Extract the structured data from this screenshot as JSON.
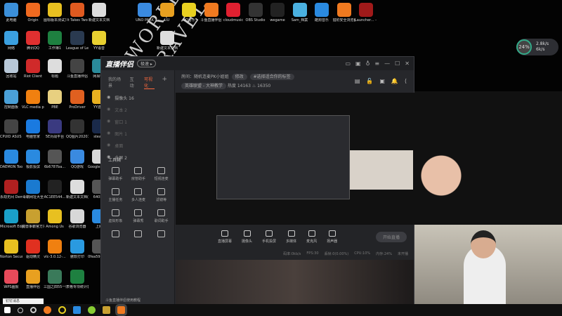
{
  "desktop": {
    "decor": [
      "WORLD",
      "TRAVEL"
    ],
    "columns": [
      [
        {
          "label": "此电脑",
          "color": "#3b8fd9"
        },
        {
          "label": "网络",
          "color": "#3ba0e0"
        },
        {
          "label": "回收站",
          "color": "#b8c8d8"
        },
        {
          "label": "控制面板",
          "color": "#4aa0d8"
        },
        {
          "label": "CPUID ASUS CPU-Z",
          "color": "#444"
        },
        {
          "label": "DAEMON Tools Lite",
          "color": "#2a8ae0"
        },
        {
          "label": "永劫无间 Demo",
          "color": "#b02020"
        },
        {
          "label": "Microsoft Edge",
          "color": "#1aa0c8"
        },
        {
          "label": "Norton Security",
          "color": "#e8c020"
        },
        {
          "label": "WPS画报",
          "color": "#e84a5a"
        }
      ],
      [
        {
          "label": "Origin",
          "color": "#f06a20"
        },
        {
          "label": "腾讯QQ",
          "color": "#e03030"
        },
        {
          "label": "Riot Client",
          "color": "#d02a2a"
        },
        {
          "label": "VLC media player",
          "color": "#f08010"
        },
        {
          "label": "电脑管家",
          "color": "#1a7ae0"
        },
        {
          "label": "极影投屏",
          "color": "#2a8ae0"
        },
        {
          "label": "毒霸网址大全",
          "color": "#1a7ad0"
        },
        {
          "label": "魔兽争霸官方对战平台",
          "color": "#c8a030"
        },
        {
          "label": "驱动精灵",
          "color": "#e03020"
        },
        {
          "label": "直播伴侣",
          "color": "#e8a020"
        }
      ],
      [
        {
          "label": "图标版本测试文档",
          "color": "#e8c020"
        },
        {
          "label": "工作簿1",
          "color": "#1e8040"
        },
        {
          "label": "标题",
          "color": "#ddd"
        },
        {
          "label": "PBE",
          "color": "#e8d080"
        },
        {
          "label": "5E对战平台",
          "color": "#3a3a80"
        },
        {
          "label": "6b6787ba...",
          "color": "#555"
        },
        {
          "label": "AC1EE544...",
          "color": "#222"
        },
        {
          "label": "Among Us",
          "color": "#e8c020"
        },
        {
          "label": "vlc-3.0.12-...",
          "color": "#f08010"
        },
        {
          "label": "三国之四55一图上站",
          "color": "#3a7a5a"
        }
      ],
      [
        {
          "label": "It Takes Two",
          "color": "#e05a20"
        },
        {
          "label": "League of Legends",
          "color": "#2a3a50"
        },
        {
          "label": "斗鱼直播伴侣",
          "color": "#444"
        },
        {
          "label": "ProDriver",
          "color": "#e06020"
        },
        {
          "label": "QQ图片20201102...",
          "color": "#333"
        },
        {
          "label": "QQ游戏",
          "color": "#3a8ae0"
        },
        {
          "label": "新建文本文档(2)",
          "color": "#ddd"
        },
        {
          "label": "谷歌浏览器",
          "color": "#d8d8d8"
        },
        {
          "label": "傲软打印",
          "color": "#2a9ae0"
        },
        {
          "label": "表格专项统计表",
          "color": "#1e8040"
        }
      ],
      [
        {
          "label": "新建文本文档",
          "color": "#ddd"
        },
        {
          "label": "YY语音",
          "color": "#e8d030"
        },
        {
          "label": "网易UU",
          "color": "#2a8a9a"
        },
        {
          "label": "YY游戏",
          "color": "#e8b020"
        },
        {
          "label": "steam",
          "color": "#1a2a4a"
        },
        {
          "label": "Google Chrome",
          "color": "#d8d8d8"
        },
        {
          "label": "640F...",
          "color": "#555"
        },
        {
          "label": "上网",
          "color": "#2a8ae0"
        },
        {
          "label": "0fea5925b...",
          "color": "#555"
        }
      ]
    ],
    "top_row": [
      {
        "label": "UNO PARK",
        "color": "#3a8ae0"
      },
      {
        "label": "UU",
        "color": "#e8a020"
      },
      {
        "label": "QQ音乐",
        "color": "#e8d020"
      },
      {
        "label": "斗鱼直播伴侣",
        "color": "#f07a20"
      },
      {
        "label": "cloudmusic",
        "color": "#e02030"
      },
      {
        "label": "OBS Studio",
        "color": "#333"
      },
      {
        "label": "wegame",
        "color": "#222"
      },
      {
        "label": "Sam_档案",
        "color": "#4ab0e0"
      },
      {
        "label": "酷狗音乐",
        "color": "#2a8ae0"
      },
      {
        "label": "猎豹安全浏览器",
        "color": "#f07a20"
      },
      {
        "label": "Launcher... - 快捷方式",
        "color": "#a01a1a"
      }
    ],
    "extra": [
      {
        "label": "新建文本文档",
        "color": "#ddd"
      }
    ]
  },
  "app": {
    "logo": "直播伴侣",
    "badge": "极速 ▸",
    "window_buttons": [
      "▭",
      "▣",
      "♁",
      "≡",
      "—",
      "☐",
      "✕"
    ],
    "tabs": [
      "我的场景",
      "互动",
      "可视化"
    ],
    "add": "+",
    "scenes": [
      {
        "label": "摄像头 16",
        "on": true
      },
      {
        "label": "文本 2",
        "on": false
      },
      {
        "label": "窗口 1",
        "on": false
      },
      {
        "label": "图片 1",
        "on": false
      },
      {
        "label": "桌面",
        "on": false
      },
      {
        "label": "全屏 2",
        "on": true
      }
    ],
    "tools_title": "工具箱",
    "tools": [
      "弹幕助手",
      "房管助手",
      "短视连麦",
      "主播任务",
      "多人连麦",
      "滤镜等",
      "虚拟形象",
      "弹幕秀",
      "歌词助手",
      "",
      "",
      ""
    ],
    "tip": "斗鱼直播伴侣使用教程",
    "header": {
      "title_label": "房间：",
      "title": "随机连麦PK小姐姐",
      "edit": "修改",
      "tag": "#选择适合你的标签",
      "category": "英雄联盟 - 大神教学",
      "fans_label": "热度",
      "fans": "14163",
      "hot": "16350"
    },
    "header_icons": [
      "▤",
      "🔓",
      "▣",
      "🔔",
      "⟨"
    ],
    "bottom": [
      "直播屏幕",
      "摄像头",
      "手机投屏",
      "多媒体",
      "麦克风",
      "扬声器"
    ],
    "go_live": "开始直播",
    "stats": [
      "码率:0kb/s",
      "FPS:30",
      "丢帧:0(0.00%)",
      "CPU:10%",
      "内存:24%",
      "未开播"
    ]
  },
  "gauge": {
    "percent": "24%",
    "up": "2.8k/s",
    "down": "6k/s"
  },
  "notification": "钉钉消息",
  "colors": {
    "accent": "#ff6a3d"
  }
}
